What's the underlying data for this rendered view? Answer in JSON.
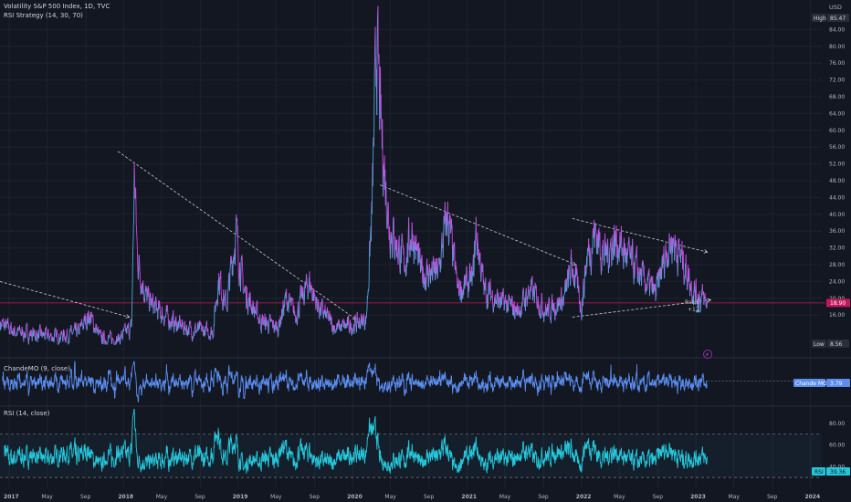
{
  "header": {
    "title": "Volatility S&P 500 Index, 1D, TVC",
    "strategy": "RSI Strategy (14, 30, 70)"
  },
  "price_pane": {
    "currency": "USD",
    "high_label": "High",
    "high_value": "85.47",
    "low_label": "Low",
    "low_value": "8.56",
    "last_value": "18.90",
    "annotation_lines": [
      "RsiLE",
      "+12"
    ],
    "pager_glyph": "⚡"
  },
  "chande_pane": {
    "legend": "ChandeMO (9, close)",
    "badge_label": "Chande MO",
    "badge_value": "3.79"
  },
  "rsi_pane": {
    "legend": "RSI (14, close)",
    "badge_label": "RSI",
    "badge_value": "39.36"
  },
  "colors": {
    "background": "#131722",
    "grid": "#1e222d",
    "axis_text": "#b2b5be",
    "price_up": "#4aa8d8",
    "price_down": "#d93ee0",
    "chande": "#5b8def",
    "rsi": "#26c6da",
    "last_price_line": "#c2185b",
    "trend_line": "#c8cbd3"
  },
  "chart_data": [
    {
      "type": "line",
      "title": "Volatility S&P 500 Index, 1D, TVC",
      "ylim": [
        8,
        88
      ],
      "y_ticks": [
        16,
        20,
        24,
        28,
        32,
        36,
        40,
        44,
        48,
        52,
        56,
        60,
        64,
        68,
        72,
        76,
        80,
        84
      ],
      "x_ticks": [
        "2017",
        "May",
        "Sep",
        "2018",
        "May",
        "Sep",
        "2019",
        "May",
        "Sep",
        "2020",
        "May",
        "Sep",
        "2021",
        "May",
        "Sep",
        "2022",
        "May",
        "Sep",
        "2023",
        "May",
        "Sep",
        "2024"
      ],
      "x_range": [
        2016.92,
        2024.1
      ],
      "series_points": [
        [
          2016.92,
          14
        ],
        [
          2017.05,
          12
        ],
        [
          2017.2,
          11.5
        ],
        [
          2017.4,
          10.8
        ],
        [
          2017.6,
          11.8
        ],
        [
          2017.7,
          16
        ],
        [
          2017.8,
          10.5
        ],
        [
          2017.95,
          10.2
        ],
        [
          2018.07,
          13
        ],
        [
          2018.095,
          50
        ],
        [
          2018.12,
          30
        ],
        [
          2018.2,
          20
        ],
        [
          2018.3,
          17
        ],
        [
          2018.45,
          14
        ],
        [
          2018.6,
          12.5
        ],
        [
          2018.78,
          12
        ],
        [
          2018.83,
          25
        ],
        [
          2018.9,
          18
        ],
        [
          2018.98,
          36
        ],
        [
          2019.05,
          22
        ],
        [
          2019.2,
          14.5
        ],
        [
          2019.35,
          13
        ],
        [
          2019.42,
          20
        ],
        [
          2019.5,
          16
        ],
        [
          2019.62,
          24
        ],
        [
          2019.7,
          18
        ],
        [
          2019.85,
          13
        ],
        [
          2020.0,
          13.5
        ],
        [
          2020.12,
          15
        ],
        [
          2020.17,
          40
        ],
        [
          2020.21,
          82
        ],
        [
          2020.25,
          60
        ],
        [
          2020.32,
          38
        ],
        [
          2020.45,
          28
        ],
        [
          2020.52,
          36
        ],
        [
          2020.6,
          26
        ],
        [
          2020.75,
          26
        ],
        [
          2020.83,
          40
        ],
        [
          2020.92,
          22
        ],
        [
          2021.05,
          24
        ],
        [
          2021.08,
          36
        ],
        [
          2021.15,
          22
        ],
        [
          2021.3,
          19
        ],
        [
          2021.45,
          17
        ],
        [
          2021.55,
          22
        ],
        [
          2021.7,
          17
        ],
        [
          2021.85,
          20
        ],
        [
          2021.92,
          28
        ],
        [
          2022.0,
          18
        ],
        [
          2022.05,
          30
        ],
        [
          2022.12,
          36
        ],
        [
          2022.2,
          30
        ],
        [
          2022.3,
          34
        ],
        [
          2022.45,
          28
        ],
        [
          2022.55,
          24
        ],
        [
          2022.65,
          21
        ],
        [
          2022.75,
          32
        ],
        [
          2022.8,
          34
        ],
        [
          2022.9,
          28
        ],
        [
          2022.98,
          22
        ],
        [
          2023.05,
          20
        ],
        [
          2023.1,
          18.9
        ]
      ],
      "trend_lines": [
        [
          [
            2016.92,
            24
          ],
          [
            2018.05,
            15.5
          ]
        ],
        [
          [
            2017.95,
            55
          ],
          [
            2020.03,
            15
          ]
        ],
        [
          [
            2020.24,
            47
          ],
          [
            2021.95,
            28
          ]
        ],
        [
          [
            2021.92,
            39
          ],
          [
            2023.1,
            31
          ]
        ],
        [
          [
            2021.92,
            15.5
          ],
          [
            2023.13,
            19.6
          ]
        ]
      ],
      "last_value": 18.9,
      "high": 85.47,
      "low": 8.56
    },
    {
      "type": "line",
      "title": "ChandeMO (9, close)",
      "ylim": [
        -80,
        80
      ],
      "reference_value": 3.79,
      "last_value": 3.79
    },
    {
      "type": "line",
      "title": "RSI (14, close)",
      "ylim": [
        20,
        95
      ],
      "y_ticks": [
        40,
        60,
        80
      ],
      "reference_lines": [
        70,
        30
      ],
      "last_value": 39.36
    }
  ]
}
